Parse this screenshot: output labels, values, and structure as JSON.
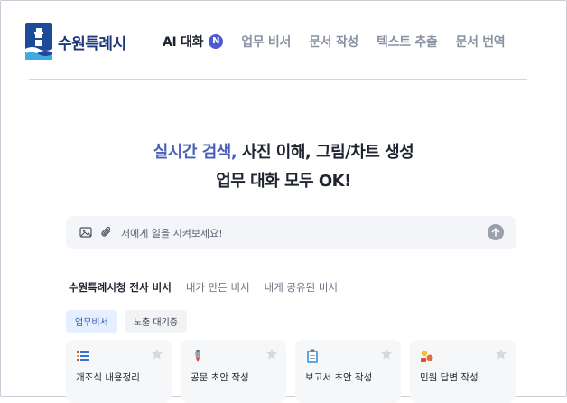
{
  "app": {
    "name": "수원특례시"
  },
  "nav": {
    "items": [
      {
        "label": "AI 대화",
        "badge": "N",
        "active": true
      },
      {
        "label": "업무 비서"
      },
      {
        "label": "문서 작성"
      },
      {
        "label": "텍스트 추출"
      },
      {
        "label": "문서 번역"
      }
    ]
  },
  "hero": {
    "line1_accent": "실시간 검색,",
    "line1_rest": " 사진 이해, 그림/차트 생성",
    "line2": "업무 대화 모두 OK!"
  },
  "search": {
    "placeholder": "저에게 일을 시켜보세요!"
  },
  "tabs": [
    {
      "label": "수원특례시청 전사 비서",
      "active": true
    },
    {
      "label": "내가 만든 비서"
    },
    {
      "label": "내게 공유된 비서"
    }
  ],
  "chips": [
    {
      "label": "업무비서",
      "active": true
    },
    {
      "label": "노출 대기중"
    }
  ],
  "cards": [
    {
      "title": "개조식 내용정리",
      "icon": "list-icon"
    },
    {
      "title": "공문 초안 작성",
      "icon": "pen-icon"
    },
    {
      "title": "보고서 초안 작성",
      "icon": "clipboard-icon"
    },
    {
      "title": "민원 답변 작성",
      "icon": "people-icon"
    }
  ],
  "colors": {
    "brand": "#1d3a78",
    "accent": "#4a5fb8",
    "badge": "#4c5bd4"
  }
}
